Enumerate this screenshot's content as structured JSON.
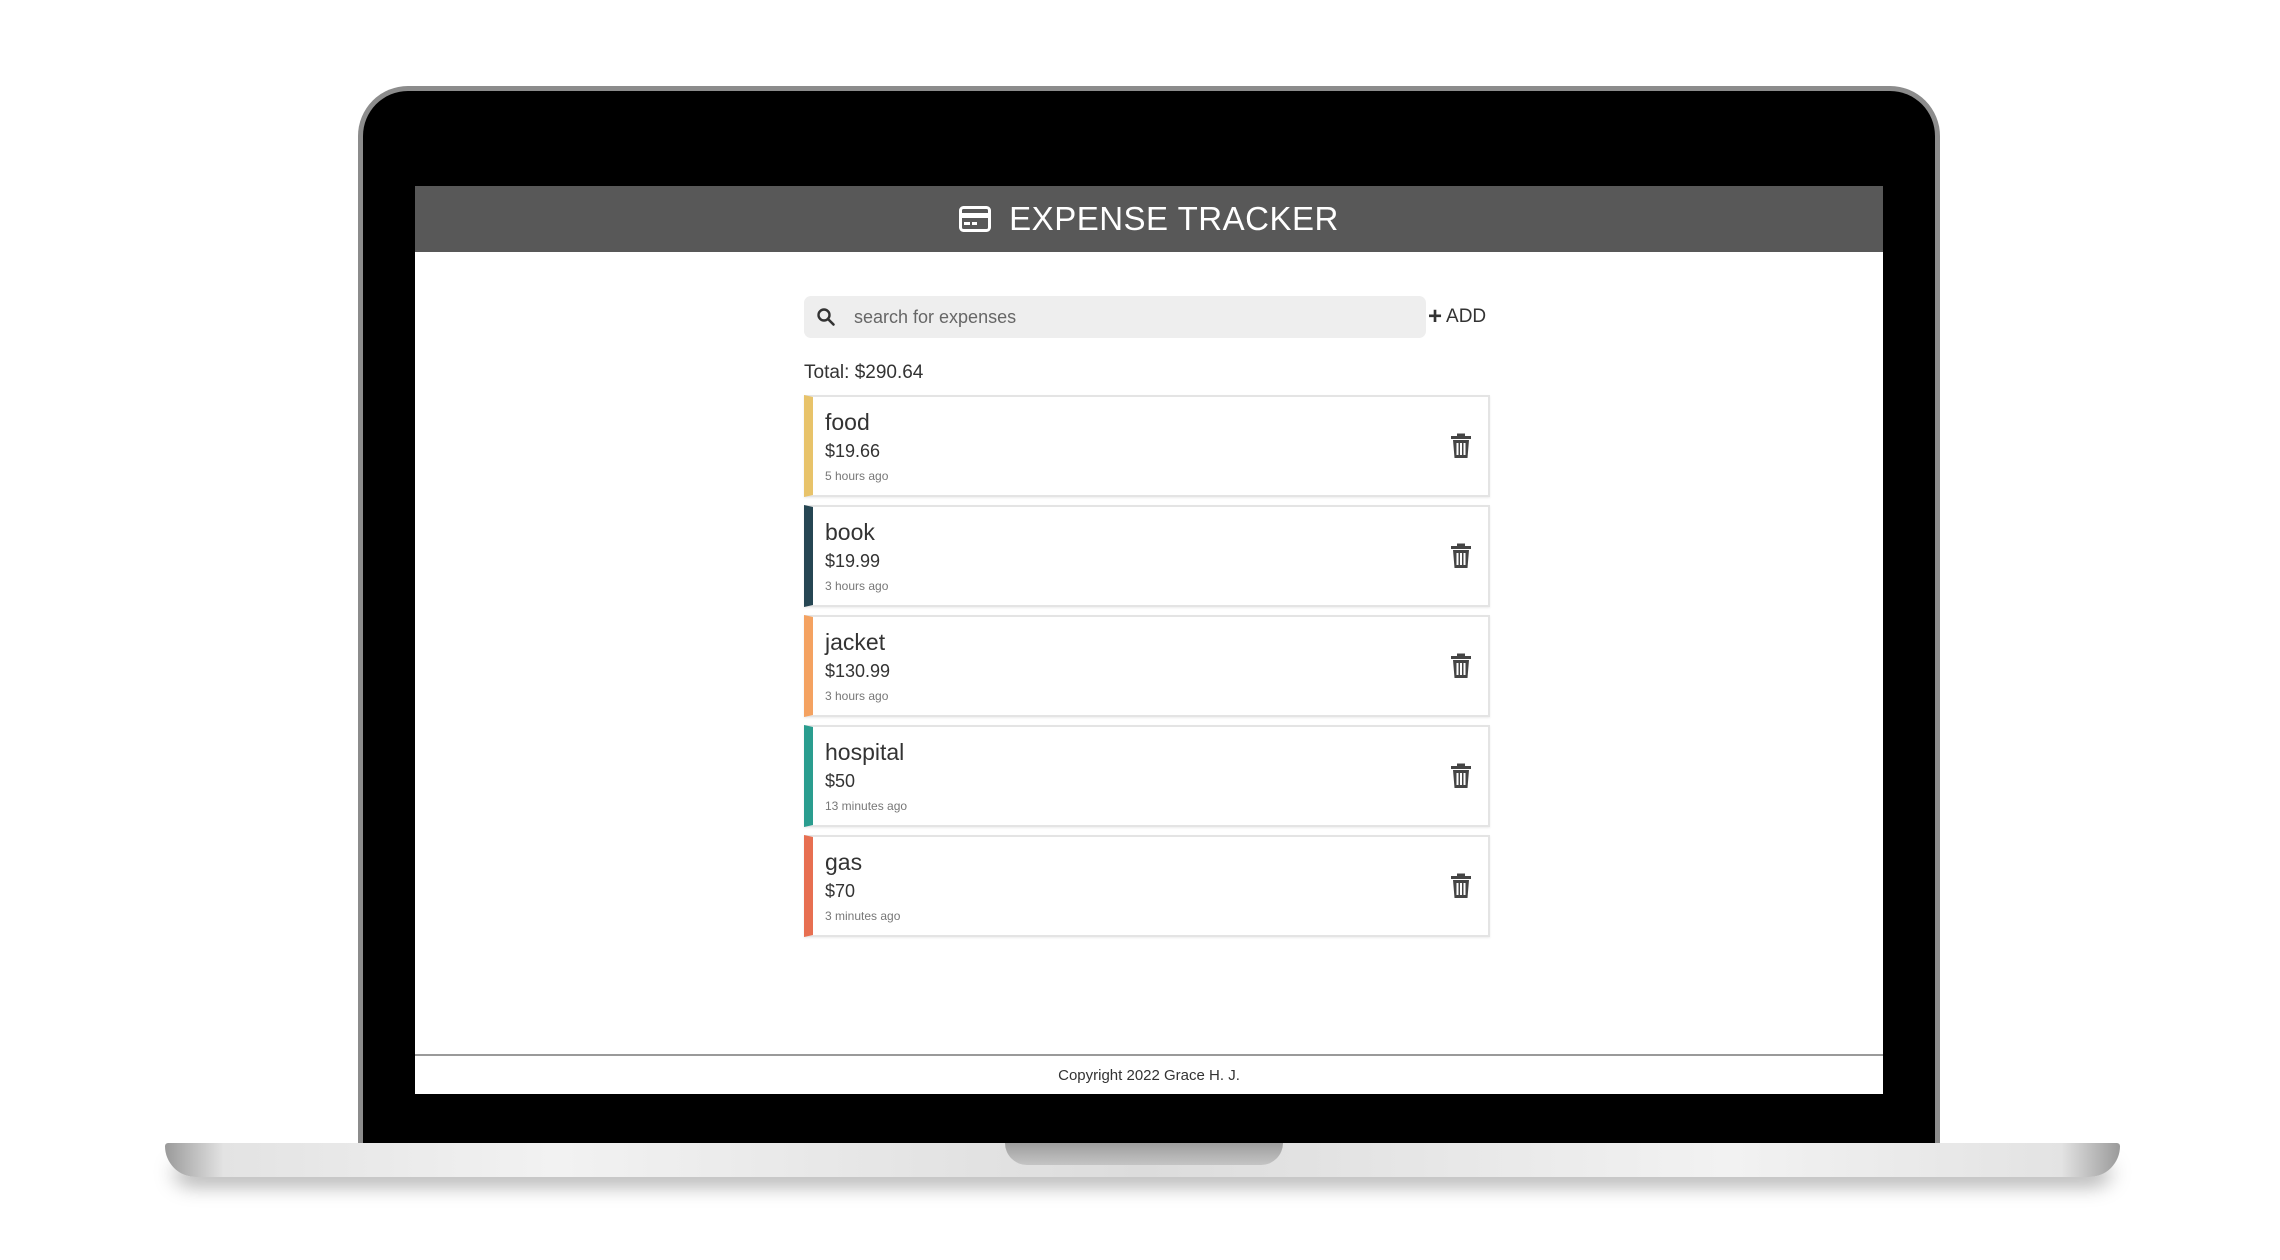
{
  "header": {
    "title": "EXPENSE TRACKER",
    "icon": "credit-card-icon"
  },
  "search": {
    "placeholder": "search for expenses",
    "value": ""
  },
  "add_label": "ADD",
  "total": "Total: $290.64",
  "expenses": [
    {
      "name": "food",
      "amount": "$19.66",
      "time": "5 hours ago",
      "color": "#e8c36a"
    },
    {
      "name": "book",
      "amount": "$19.99",
      "time": "3 hours ago",
      "color": "#264653"
    },
    {
      "name": "jacket",
      "amount": "$130.99",
      "time": "3 hours ago",
      "color": "#f4a261"
    },
    {
      "name": "hospital",
      "amount": "$50",
      "time": "13 minutes ago",
      "color": "#2a9d8f"
    },
    {
      "name": "gas",
      "amount": "$70",
      "time": "3 minutes ago",
      "color": "#e76f51"
    }
  ],
  "footer": {
    "copyright": "Copyright 2022 Grace H. J."
  },
  "colors": {
    "header_bg": "#585858",
    "search_bg": "#eeeeee"
  }
}
